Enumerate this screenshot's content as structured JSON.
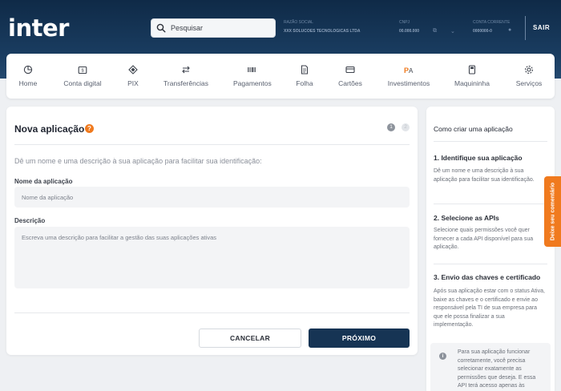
{
  "header": {
    "logo": "inter",
    "search_placeholder": "Pesquisar",
    "account": [
      {
        "label": "RAZÃO SOCIAL",
        "value": "XXX SOLUCOES TECNOLOGICAS LTDA"
      },
      {
        "label": "CNPJ",
        "value": "00.000.000"
      },
      {
        "label": "CONTA CORRENTE",
        "value": "0000000-0"
      }
    ],
    "logout_label": "SAIR"
  },
  "nav": {
    "items": [
      {
        "label": "Home",
        "icon": "pie-chart-icon"
      },
      {
        "label": "Conta digital",
        "icon": "wallet-icon"
      },
      {
        "label": "PIX",
        "icon": "pix-icon"
      },
      {
        "label": "Transferências",
        "icon": "transfer-arrows-icon"
      },
      {
        "label": "Pagamentos",
        "icon": "barcode-icon"
      },
      {
        "label": "Folha",
        "icon": "document-icon"
      },
      {
        "label": "Cartões",
        "icon": "card-icon"
      },
      {
        "label": "Investimentos",
        "icon": "investments-icon"
      },
      {
        "label": "Maquininha",
        "icon": "pos-machine-icon"
      },
      {
        "label": "Serviços",
        "icon": "gear-icon"
      }
    ]
  },
  "form": {
    "title": "Nova aplicação",
    "help_icon": "?",
    "step_current": "1",
    "step_next": "2",
    "intro": "Dê um nome e uma descrição à sua aplicação para facilitar sua identificação:",
    "name_label": "Nome da aplicação",
    "name_placeholder": "Nome da aplicação",
    "desc_label": "Descrição",
    "desc_placeholder": "Escreva uma descrição para facilitar a gestão das suas aplicações ativas",
    "cancel_label": "CANCELAR",
    "next_label": "PRÓXIMO"
  },
  "guide": {
    "title": "Como criar uma aplicação",
    "steps": [
      {
        "heading": "1. Identifique sua aplicação",
        "text": "Dê um nome e uma descrição à sua aplicação para facilitar sua identificação."
      },
      {
        "heading": "2. Selecione as APIs",
        "text": "Selecione quais permissões você quer fornecer a cada API disponível para sua aplicação."
      },
      {
        "heading": "3. Envio das chaves e certificado",
        "text": "Após sua aplicação estar com o status Ativa, baixe as chaves e o certificado e envie ao responsável pela TI de sua empresa para que ele possa finalizar a sua implementação."
      }
    ],
    "info_icon": "i",
    "info": "Para sua aplicação funcionar corretamente, você precisa selecionar exatamente as permissões que deseja. E essa API terá acesso apenas às informações das"
  },
  "feedback_label": "Deixe seu comentário",
  "colors": {
    "brand_orange": "#f07a1e",
    "header_navy": "#0f2a47",
    "primary_button": "#163454"
  }
}
